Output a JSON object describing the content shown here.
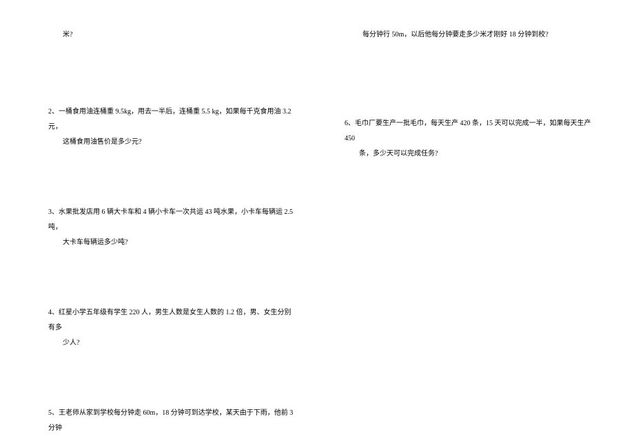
{
  "leftColumn": {
    "fragment1": "米?",
    "q2": {
      "label": "2、",
      "line1": "一桶食用油连桶重 9.5kg，用去一半后，连桶重 5.5 kg，如果每千克食用油 3.2 元，",
      "line2": "这桶食用油售价是多少元?"
    },
    "q3": {
      "label": "3、",
      "line1": "水果批发店用 6 辆大卡车和 4 辆小卡车一次共运 43 吨水果，小卡车每辆运 2.5 吨，",
      "line2": "大卡车每辆运多少吨?"
    },
    "q4": {
      "label": "4、",
      "line1": "红星小学五年级有学生 220 人，男生人数是女生人数的 1.2 倍，男、女生分别有多",
      "line2": "少人?"
    },
    "q5": {
      "label": "5、",
      "line1": "王老师从家到学校每分钟走 60m，18 分钟可到达学校，某天由于下雨，他前 3 分钟"
    }
  },
  "rightColumn": {
    "q5cont": "每分钟行 50m，以后他每分钟要走多少米才刚好 18 分钟到校?",
    "q6": {
      "label": "6、",
      "line1": "毛巾厂要生产一批毛巾，每天生产 420 条，15 天可以完成一半，如果每天生产 450",
      "line2": "条，多少天可以完成任务?"
    }
  }
}
